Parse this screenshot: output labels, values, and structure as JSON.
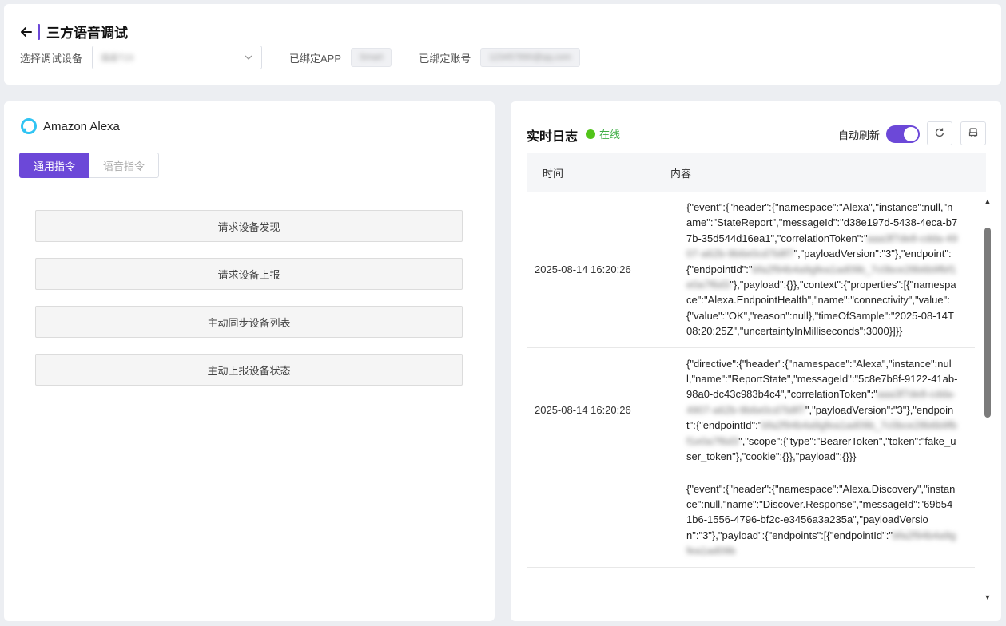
{
  "header": {
    "title": "三方语音调试",
    "device_label": "选择调试设备",
    "device_value": "插座T23",
    "app_label": "已绑定APP",
    "app_value": "Smart",
    "account_label": "已绑定账号",
    "account_value": "123457890@qq.com"
  },
  "left": {
    "platform_name": "Amazon Alexa",
    "tabs": [
      {
        "label": "通用指令"
      },
      {
        "label": "语音指令"
      }
    ],
    "commands": [
      {
        "label": "请求设备发现"
      },
      {
        "label": "请求设备上报"
      },
      {
        "label": "主动同步设备列表"
      },
      {
        "label": "主动上报设备状态"
      }
    ]
  },
  "log": {
    "title": "实时日志",
    "status": "在线",
    "auto_refresh_label": "自动刷新",
    "auto_refresh_on": true,
    "columns": {
      "time": "时间",
      "content": "内容"
    },
    "rows": [
      {
        "time": "2025-08-14 16:20:26",
        "parts": [
          {
            "t": "{\"event\":{\"header\":{\"namespace\":\"Alexa\",\"instance\":null,\"name\":\"StateReport\",\"messageId\":\"d38e197d-5438-4eca-b77b-35d544d16ea1\",\"correlationToken\":\""
          },
          {
            "t": "aaa3f7de8-cdda-4907-a62b-9b6e0cd7b8f7",
            "blur": true
          },
          {
            "t": "\",\"payloadVersion\":\"3\"},\"endpoint\":{\"endpointId\":\""
          },
          {
            "t": "bfa2f94b4a9gfea1ad09b_7c0bce28b6b9fbf1e0a7f6d3",
            "blur": true
          },
          {
            "t": "\"},\"payload\":{}},\"context\":{\"properties\":[{\"namespace\":\"Alexa.EndpointHealth\",\"name\":\"connectivity\",\"value\":{\"value\":\"OK\",\"reason\":null},\"timeOfSample\":\"2025-08-14T08:20:25Z\",\"uncertaintyInMilliseconds\":3000}]}}"
          }
        ]
      },
      {
        "time": "2025-08-14 16:20:26",
        "parts": [
          {
            "t": "{\"directive\":{\"header\":{\"namespace\":\"Alexa\",\"instance\":null,\"name\":\"ReportState\",\"messageId\":\"5c8e7b8f-9122-41ab-98a0-dc43c983b4c4\",\"correlationToken\":\""
          },
          {
            "t": "aaa3f7de8-cdda-4907-a62b-9b6e0cd7b8f7",
            "blur": true
          },
          {
            "t": "\",\"payloadVersion\":\"3\"},\"endpoint\":{\"endpointId\":\""
          },
          {
            "t": "bfa2f94b4a9gfea1ad09b_7c0bce28b6b9fbf1e0a7f6d3",
            "blur": true
          },
          {
            "t": "\",\"scope\":{\"type\":\"BearerToken\",\"token\":\"fake_user_token\"},\"cookie\":{}},\"payload\":{}}}"
          }
        ]
      },
      {
        "time": "",
        "parts": [
          {
            "t": "{\"event\":{\"header\":{\"namespace\":\"Alexa.Discovery\",\"instance\":null,\"name\":\"Discover.Response\",\"messageId\":\"69b541b6-1556-4796-bf2c-e3456a3a235a\",\"payloadVersion\":\"3\"},\"payload\":{\"endpoints\":[{\"endpointId\":\""
          },
          {
            "t": "bfa2f94b4a9gfea1ad09b",
            "blur": true
          }
        ]
      }
    ]
  },
  "colors": {
    "accent": "#6c48d8",
    "online": "#52c41a"
  }
}
